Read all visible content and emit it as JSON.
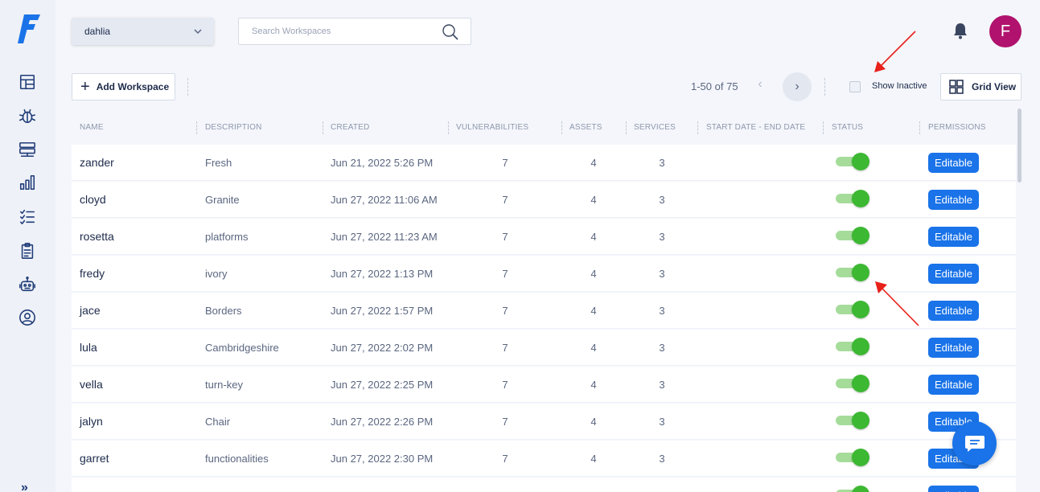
{
  "app": {
    "logo_letter": "F"
  },
  "sidebar": {
    "items": [
      {
        "name": "dashboard-icon"
      },
      {
        "name": "bug-icon"
      },
      {
        "name": "servers-icon"
      },
      {
        "name": "reports-icon"
      },
      {
        "name": "checklist-icon"
      },
      {
        "name": "clipboard-icon"
      },
      {
        "name": "robot-icon"
      },
      {
        "name": "user-circle-icon"
      }
    ],
    "expand_label": "»"
  },
  "header": {
    "workspace_selected": "dahlia",
    "search_placeholder": "Search Workspaces",
    "avatar_letter": "F",
    "avatar_color": "#b0126d"
  },
  "toolbar": {
    "add_label": "Add Workspace",
    "pagination_text": "1-50 of 75",
    "prev_label": "‹",
    "next_label": "›",
    "show_inactive_label": "Show Inactive",
    "grid_view_label": "Grid View"
  },
  "table": {
    "columns": [
      "NAME",
      "DESCRIPTION",
      "CREATED",
      "VULNERABILITIES",
      "ASSETS",
      "SERVICES",
      "START DATE - END DATE",
      "STATUS",
      "PERMISSIONS"
    ],
    "rows": [
      {
        "name": "zander",
        "description": "Fresh",
        "created": "Jun 21, 2022 5:26 PM",
        "vulnerabilities": "7",
        "assets": "4",
        "services": "3",
        "dates": "",
        "active": true,
        "permission": "Editable"
      },
      {
        "name": "cloyd",
        "description": "Granite",
        "created": "Jun 27, 2022 11:06 AM",
        "vulnerabilities": "7",
        "assets": "4",
        "services": "3",
        "dates": "",
        "active": true,
        "permission": "Editable"
      },
      {
        "name": "rosetta",
        "description": "platforms",
        "created": "Jun 27, 2022 11:23 AM",
        "vulnerabilities": "7",
        "assets": "4",
        "services": "3",
        "dates": "",
        "active": true,
        "permission": "Editable"
      },
      {
        "name": "fredy",
        "description": "ivory",
        "created": "Jun 27, 2022 1:13 PM",
        "vulnerabilities": "7",
        "assets": "4",
        "services": "3",
        "dates": "",
        "active": true,
        "permission": "Editable"
      },
      {
        "name": "jace",
        "description": "Borders",
        "created": "Jun 27, 2022 1:57 PM",
        "vulnerabilities": "7",
        "assets": "4",
        "services": "3",
        "dates": "",
        "active": true,
        "permission": "Editable"
      },
      {
        "name": "lula",
        "description": "Cambridgeshire",
        "created": "Jun 27, 2022 2:02 PM",
        "vulnerabilities": "7",
        "assets": "4",
        "services": "3",
        "dates": "",
        "active": true,
        "permission": "Editable"
      },
      {
        "name": "vella",
        "description": "turn-key",
        "created": "Jun 27, 2022 2:25 PM",
        "vulnerabilities": "7",
        "assets": "4",
        "services": "3",
        "dates": "",
        "active": true,
        "permission": "Editable"
      },
      {
        "name": "jalyn",
        "description": "Chair",
        "created": "Jun 27, 2022 2:26 PM",
        "vulnerabilities": "7",
        "assets": "4",
        "services": "3",
        "dates": "",
        "active": true,
        "permission": "Editable"
      },
      {
        "name": "garret",
        "description": "functionalities",
        "created": "Jun 27, 2022 2:30 PM",
        "vulnerabilities": "7",
        "assets": "4",
        "services": "3",
        "dates": "",
        "active": true,
        "permission": "Editable"
      },
      {
        "name": "",
        "description": "",
        "created": "",
        "vulnerabilities": "",
        "assets": "",
        "services": "",
        "dates": "",
        "active": true,
        "permission": "Editable"
      }
    ]
  },
  "colors": {
    "accent": "#1a73e8",
    "toggle_on": "#3cb832",
    "annotation_arrow": "#e8211a"
  }
}
